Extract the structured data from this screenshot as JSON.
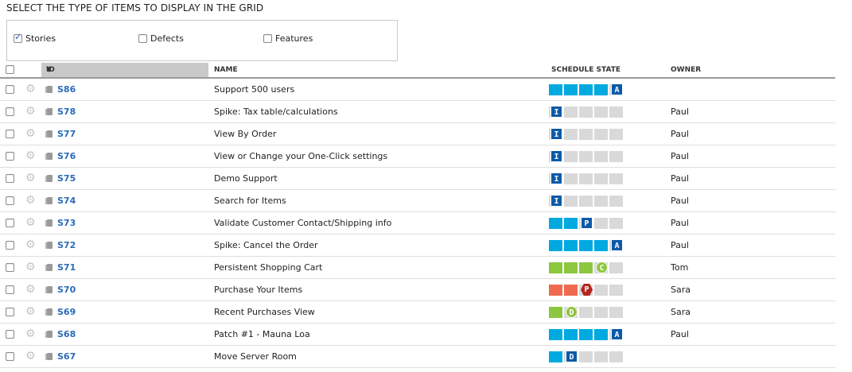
{
  "title": "SELECT THE TYPE OF ITEMS TO DISPLAY IN THE GRID",
  "types": [
    {
      "label": "Stories",
      "checked": true
    },
    {
      "label": "Defects",
      "checked": false
    },
    {
      "label": "Features",
      "checked": false
    }
  ],
  "columns": {
    "id": "ID",
    "name": "NAME",
    "schedule": "SCHEDULE STATE",
    "owner": "OWNER"
  },
  "colors": {
    "blue": "#00a9e0",
    "green": "#8dc63f",
    "red": "#ef6a4f",
    "badge_blue": "#0b5aa8",
    "badge_red": "#b3261e"
  },
  "rows": [
    {
      "id": "S86",
      "name": "Support 500 users",
      "owner": "",
      "state": "A",
      "filled": 4,
      "style": "blue",
      "badge": "sq"
    },
    {
      "id": "S78",
      "name": "Spike: Tax table/calculations",
      "owner": "Paul",
      "state": "I",
      "filled": 0,
      "style": "blue",
      "badge": "sq"
    },
    {
      "id": "S77",
      "name": "View By Order",
      "owner": "Paul",
      "state": "I",
      "filled": 0,
      "style": "blue",
      "badge": "sq"
    },
    {
      "id": "S76",
      "name": "View or Change your One-Click settings",
      "owner": "Paul",
      "state": "I",
      "filled": 0,
      "style": "blue",
      "badge": "sq"
    },
    {
      "id": "S75",
      "name": "Demo Support",
      "owner": "Paul",
      "state": "I",
      "filled": 0,
      "style": "blue",
      "badge": "sq"
    },
    {
      "id": "S74",
      "name": "Search for Items",
      "owner": "Paul",
      "state": "I",
      "filled": 0,
      "style": "blue",
      "badge": "sq"
    },
    {
      "id": "S73",
      "name": "Validate Customer Contact/Shipping info",
      "owner": "Paul",
      "state": "P",
      "filled": 2,
      "style": "blue",
      "badge": "sq"
    },
    {
      "id": "S72",
      "name": "Spike: Cancel the Order",
      "owner": "Paul",
      "state": "A",
      "filled": 4,
      "style": "blue",
      "badge": "sq"
    },
    {
      "id": "S71",
      "name": "Persistent Shopping Cart",
      "owner": "Tom",
      "state": "C",
      "filled": 3,
      "style": "green",
      "badge": "circle"
    },
    {
      "id": "S70",
      "name": "Purchase Your Items",
      "owner": "Sara",
      "state": "P",
      "filled": 2,
      "style": "red",
      "badge": "hex"
    },
    {
      "id": "S69",
      "name": "Recent Purchases View",
      "owner": "Sara",
      "state": "D",
      "filled": 1,
      "style": "green",
      "badge": "circle"
    },
    {
      "id": "S68",
      "name": "Patch #1 - Mauna Loa",
      "owner": "Paul",
      "state": "A",
      "filled": 4,
      "style": "blue",
      "badge": "sq"
    },
    {
      "id": "S67",
      "name": "Move Server Room",
      "owner": "",
      "state": "D",
      "filled": 1,
      "style": "blue",
      "badge": "sq"
    }
  ]
}
